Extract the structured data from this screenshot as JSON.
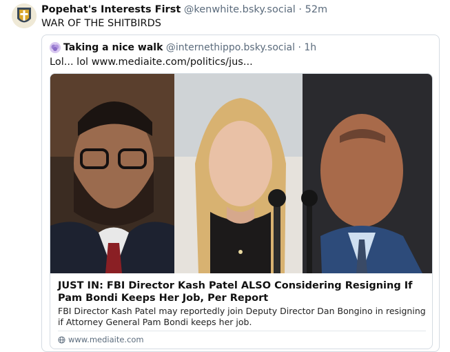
{
  "post": {
    "author_name": "Popehat's Interests First",
    "author_handle": "@kenwhite.bsky.social",
    "separator": "·",
    "time": "52m",
    "text": "WAR OF THE SHITBIRDS"
  },
  "quote": {
    "author_name": "Taking a nice walk",
    "author_handle": "@internethippo.bsky.social",
    "separator": "·",
    "time": "1h",
    "text": "Lol... lol www.mediaite.com/politics/jus..."
  },
  "link_card": {
    "title": "JUST IN: FBI Director Kash Patel ALSO Considering Resigning If Pam Bondi Keeps Her Job, Per Report",
    "description": "FBI Director Kash Patel may reportedly join Deputy Director Dan Bongino in resigning if Attorney General Pam Bondi keeps her job.",
    "domain": "www.mediaite.com"
  },
  "colors": {
    "border": "#d4dbe2",
    "muted": "#5b6b7c",
    "text": "#111111"
  },
  "icons": {
    "avatar": "avatar-shield-icon",
    "quote_avatar": "avatar-brain-icon",
    "globe": "globe-icon"
  }
}
